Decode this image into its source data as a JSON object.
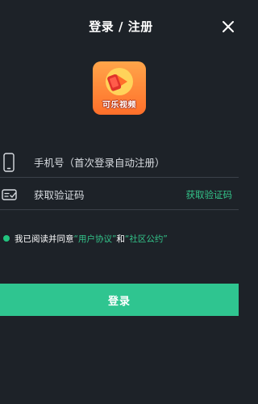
{
  "header": {
    "title": "登录 / 注册"
  },
  "logo": {
    "text": "可乐视频",
    "brand_color": "#ff7a2e"
  },
  "phone": {
    "placeholder": "手机号（首次登录自动注册）"
  },
  "code": {
    "placeholder": "获取验证码",
    "action": "获取验证码"
  },
  "agreement": {
    "prefix": "我已阅读并同意",
    "user_agreement": "“用户协议”",
    "and": "和",
    "community": "“社区公约”"
  },
  "login_button": "登录",
  "colors": {
    "accent": "#2fc590",
    "background": "#1d2228"
  },
  "icons": {
    "close": "close-icon",
    "phone": "phone-icon",
    "verify": "verify-code-icon",
    "check": "check-dot-icon"
  }
}
